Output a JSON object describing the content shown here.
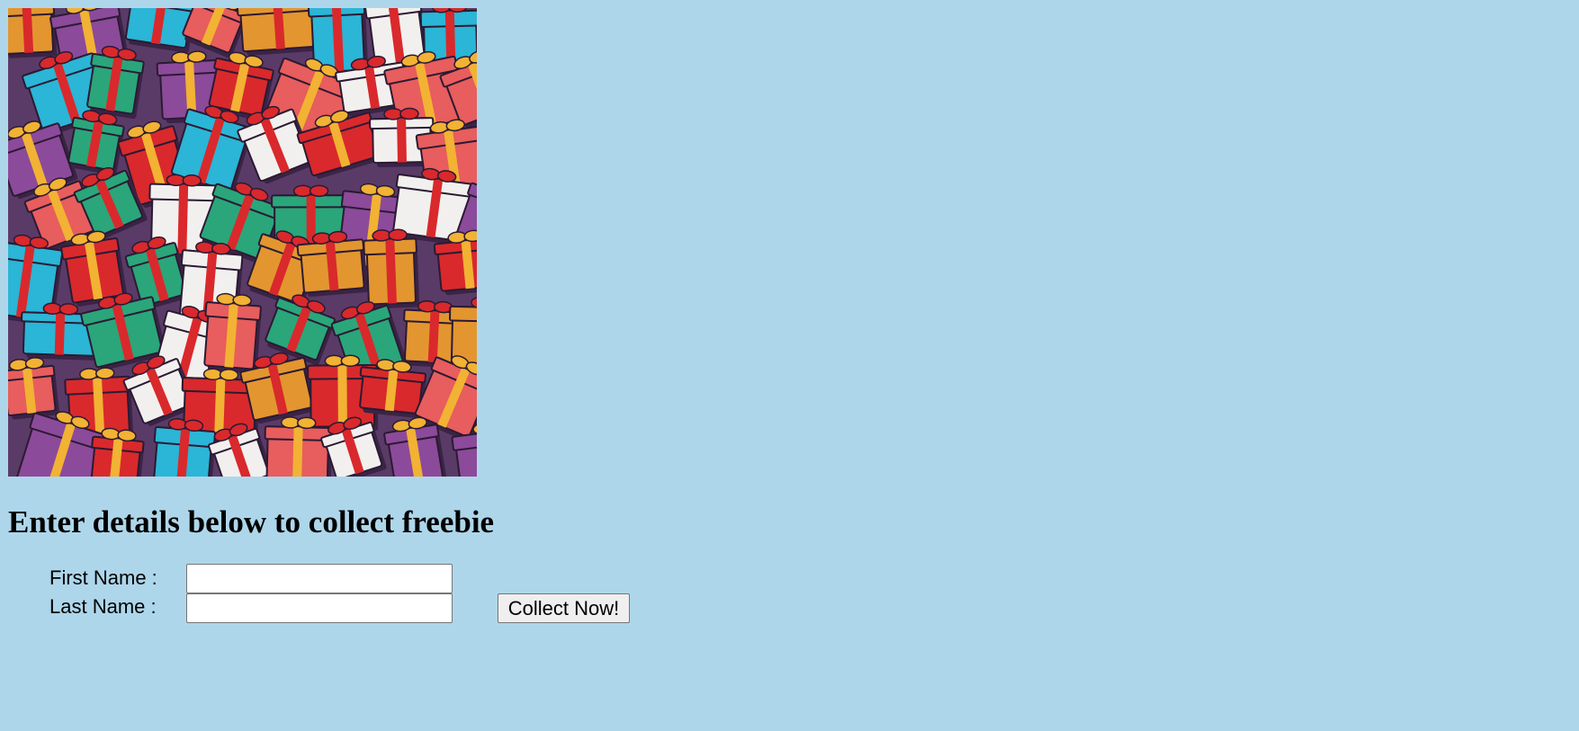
{
  "heading": "Enter details below to collect freebie",
  "banner": {
    "icon": "gift-boxes-pattern-image",
    "colors": [
      "#d9292c",
      "#2bb5d6",
      "#f2f0ee",
      "#e3962f",
      "#2aa67a",
      "#8c4a9a",
      "#e85d5d"
    ]
  },
  "form": {
    "first_name_label": "First Name :",
    "last_name_label": "Last Name :",
    "first_name_value": "",
    "last_name_value": "",
    "submit_label": "Collect Now!"
  }
}
